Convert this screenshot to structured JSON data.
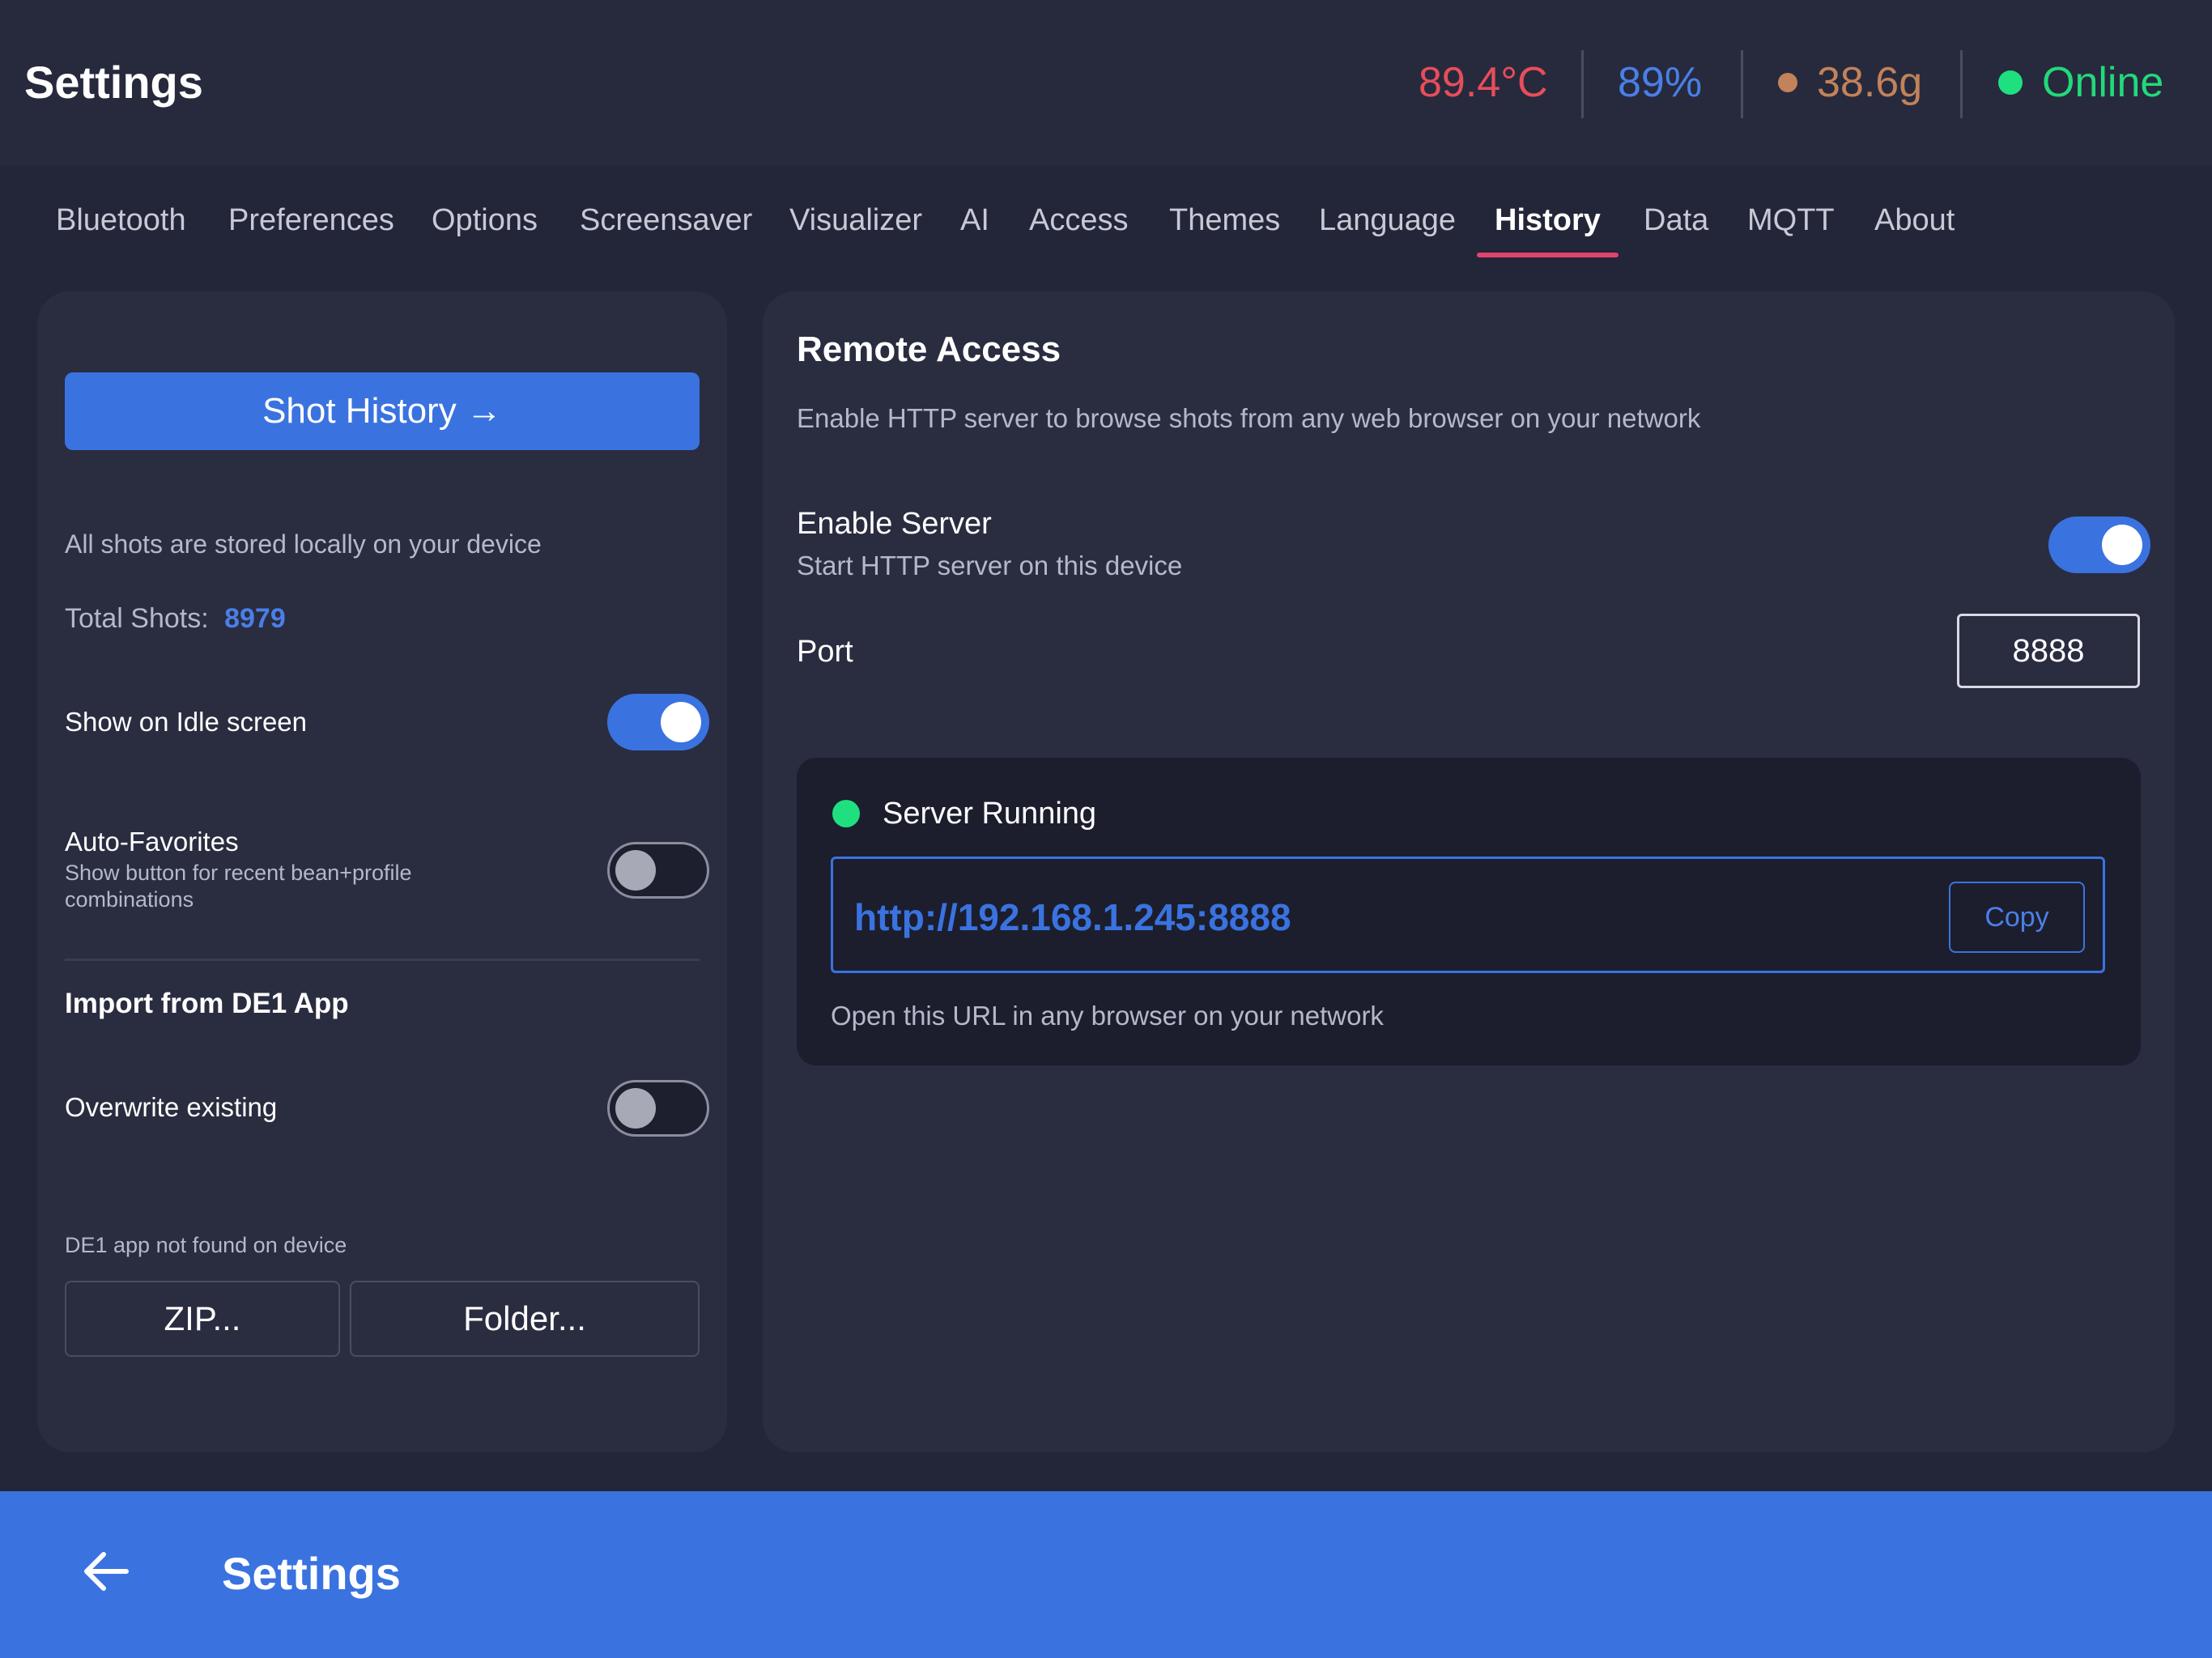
{
  "header": {
    "title": "Settings",
    "temperature": "89.4°C",
    "percent": "89%",
    "weight": "38.6g",
    "connection": "Online"
  },
  "tabs": [
    {
      "label": "Bluetooth"
    },
    {
      "label": "Preferences"
    },
    {
      "label": "Options"
    },
    {
      "label": "Screensaver"
    },
    {
      "label": "Visualizer"
    },
    {
      "label": "AI"
    },
    {
      "label": "Access"
    },
    {
      "label": "Themes"
    },
    {
      "label": "Language"
    },
    {
      "label": "History",
      "active": true
    },
    {
      "label": "Data"
    },
    {
      "label": "MQTT"
    },
    {
      "label": "About"
    }
  ],
  "left": {
    "shot_history_button": "Shot History →",
    "storage_note": "All shots are stored locally on your device",
    "total_shots_label": "Total Shots:",
    "total_shots_value": "8979",
    "show_idle_label": "Show on Idle screen",
    "show_idle_on": true,
    "auto_favorites_label": "Auto-Favorites",
    "auto_favorites_desc": "Show button for recent bean+profile combinations",
    "auto_favorites_on": false,
    "import_heading": "Import from DE1 App",
    "overwrite_label": "Overwrite existing",
    "overwrite_on": false,
    "de1_status": "DE1 app not found on device",
    "zip_button": "ZIP...",
    "folder_button": "Folder..."
  },
  "right": {
    "heading": "Remote Access",
    "description": "Enable HTTP server to browse shots from any web browser on your network",
    "enable_label": "Enable Server",
    "enable_desc": "Start HTTP server on this device",
    "enable_on": true,
    "port_label": "Port",
    "port_value": "8888",
    "server_status": "Server Running",
    "url": "http://192.168.1.245:8888",
    "copy_button": "Copy",
    "url_hint": "Open this URL in any browser on your network"
  },
  "footer": {
    "title": "Settings",
    "back_icon": "arrow-left-icon"
  },
  "colors": {
    "accent": "#3a73e0",
    "temperature": "#e84d5b",
    "weight": "#c2825a",
    "online": "#22d97a",
    "active_tab_underline": "#e0436e"
  }
}
